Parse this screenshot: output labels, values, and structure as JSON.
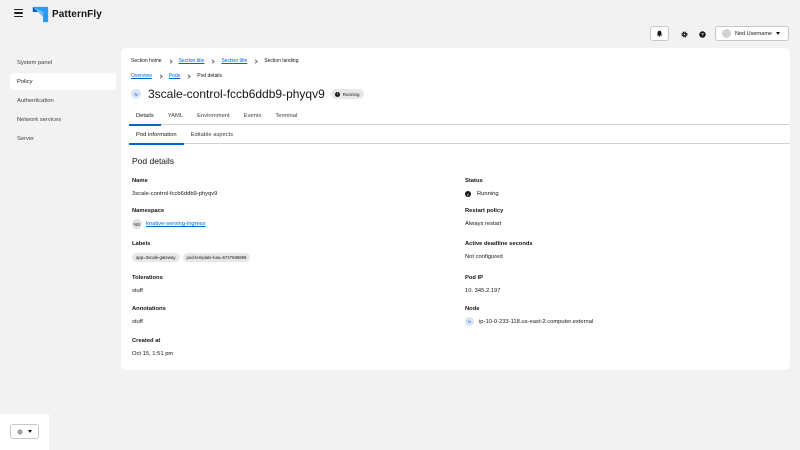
{
  "masthead": {
    "brand": "PatternFly",
    "user_name": "Ned Username"
  },
  "sidebar": {
    "items": [
      {
        "label": "System panel"
      },
      {
        "label": "Policy"
      },
      {
        "label": "Authentication"
      },
      {
        "label": "Network services"
      },
      {
        "label": "Server"
      }
    ]
  },
  "breadcrumb": {
    "items": [
      "Section home",
      "Section title",
      "Section title",
      "Section landing"
    ]
  },
  "breadcrumb2": {
    "items": [
      "Overview",
      "Pods",
      "Pod details"
    ]
  },
  "page": {
    "badge": "N",
    "title": "3scale-control-fccb6ddb9-phyqv9",
    "status": "Running"
  },
  "tabs": [
    "Details",
    "YAML",
    "Environment",
    "Events",
    "Terminal"
  ],
  "subtabs": [
    "Pod information",
    "Editable aspects"
  ],
  "details": {
    "section_title": "Pod details",
    "name_label": "Name",
    "name_value": "3scale-control-fccb6ddb9-phyqv9",
    "namespace_label": "Namespace",
    "namespace_badge": "NS",
    "namespace_value": "knative-serving-ingress",
    "labels_label": "Labels",
    "labels": [
      "app=3scale-gateway",
      "pod-template-has=6747686899"
    ],
    "tolerations_label": "Tolerations",
    "tolerations_value": "stuff",
    "annotations_label": "Annotations",
    "annotations_value": "stuff",
    "created_label": "Created at",
    "created_value": "Oct 15, 1:51 pm",
    "status_label": "Status",
    "status_value": "Running",
    "restart_label": "Restart policy",
    "restart_value": "Always restart",
    "deadline_label": "Active deadline seconds",
    "deadline_value": "Not configured",
    "podip_label": "Pod IP",
    "podip_value": "10. 345.2.197",
    "node_label": "Node",
    "node_badge": "N",
    "node_value": "ip-10-0-233-118.us-east-2.computer.external"
  },
  "colors": {
    "link": "#0066cc",
    "active_tab": "#0066cc",
    "page_bg": "#f2f2f2"
  }
}
